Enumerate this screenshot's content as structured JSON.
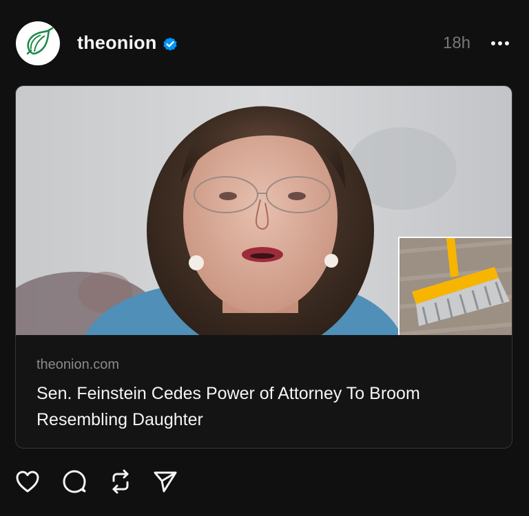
{
  "post": {
    "username": "theonion",
    "timestamp": "18h",
    "verified": true
  },
  "link_card": {
    "domain": "theonion.com",
    "title": "Sen. Feinstein Cedes Power of Attorney To Broom Resembling Daughter"
  },
  "icons": {
    "avatar": "onion-logo-icon",
    "badge": "verified-badge-icon",
    "more": "more-options-icon",
    "like": "heart-icon",
    "comment": "comment-bubble-icon",
    "repost": "repost-icon",
    "share": "send-icon"
  },
  "colors": {
    "background": "#101010",
    "verified_blue": "#0095f6",
    "onion_green": "#1e8a4a",
    "broom_yellow": "#f7b500"
  }
}
